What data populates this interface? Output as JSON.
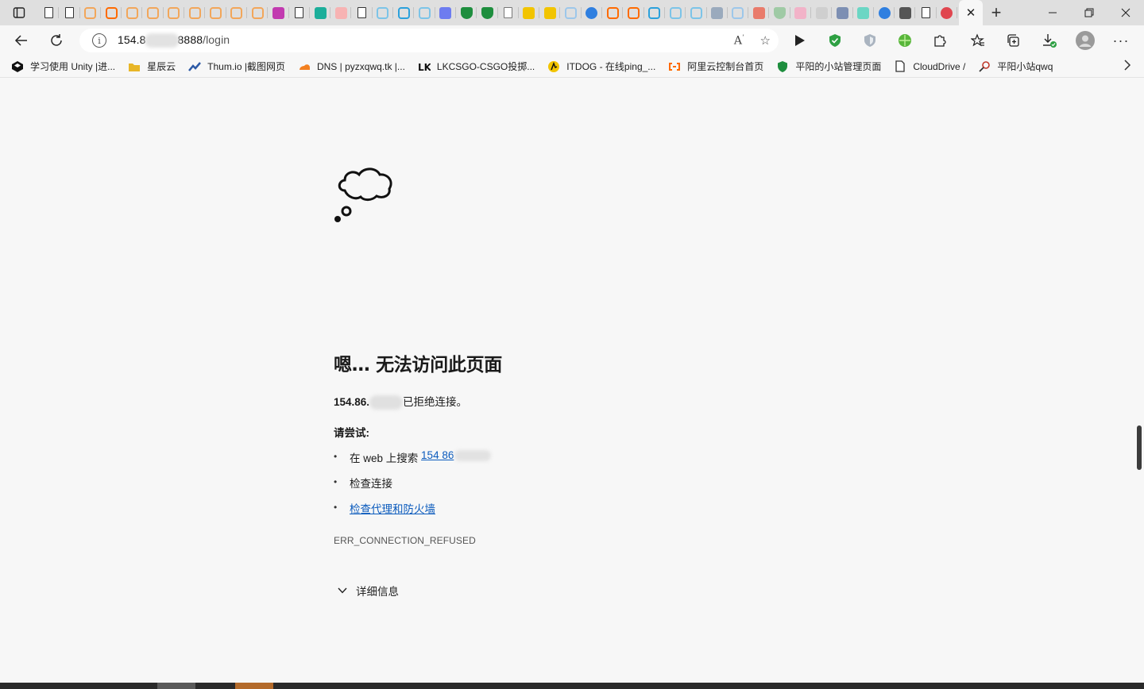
{
  "browser": {
    "address": {
      "host_prefix": "154.8",
      "host_suffix": "8888",
      "path": "/login"
    },
    "bookmarks": [
      {
        "label": "学习使用 Unity |进...",
        "icon": "unity-icon",
        "color": "#111111"
      },
      {
        "label": "星辰云",
        "icon": "folder-icon",
        "color": "#e8b627"
      },
      {
        "label": "Thum.io |截图网页",
        "icon": "thumio-icon",
        "color": "#2d5aa6"
      },
      {
        "label": "DNS | pyzxqwq.tk |...",
        "icon": "cloudflare-icon",
        "color": "#f38020"
      },
      {
        "label": "LKCSGO-CSGO投掷...",
        "icon": "lk-icon",
        "color": "#111111"
      },
      {
        "label": "ITDOG - 在线ping_...",
        "icon": "itdog-icon",
        "color": "#f2c400"
      },
      {
        "label": "阿里云控制台首页",
        "icon": "aliyun-icon",
        "color": "#ff6a00"
      },
      {
        "label": "平阳的小站管理页面",
        "icon": "shield-icon",
        "color": "#1e8e3e"
      },
      {
        "label": "CloudDrive /",
        "icon": "document-icon",
        "color": "#333333"
      },
      {
        "label": "平阳小站qwq",
        "icon": "search-key-icon",
        "color": "#c0392b"
      }
    ]
  },
  "error": {
    "title": "嗯… 无法访问此页面",
    "host_visible": "154.86.",
    "refused_text": "已拒绝连接。",
    "try_label": "请尝试:",
    "suggestions": {
      "search_prefix": "在 web 上搜索",
      "search_link": "154 86",
      "check_connection": "检查连接",
      "check_proxy": "检查代理和防火墙"
    },
    "code": "ERR_CONNECTION_REFUSED",
    "details_label": "详细信息"
  },
  "colors": {
    "link": "#0b5bbd",
    "page_bg": "#f7f7f7",
    "tabstrip_bg": "#dfdfdf"
  }
}
